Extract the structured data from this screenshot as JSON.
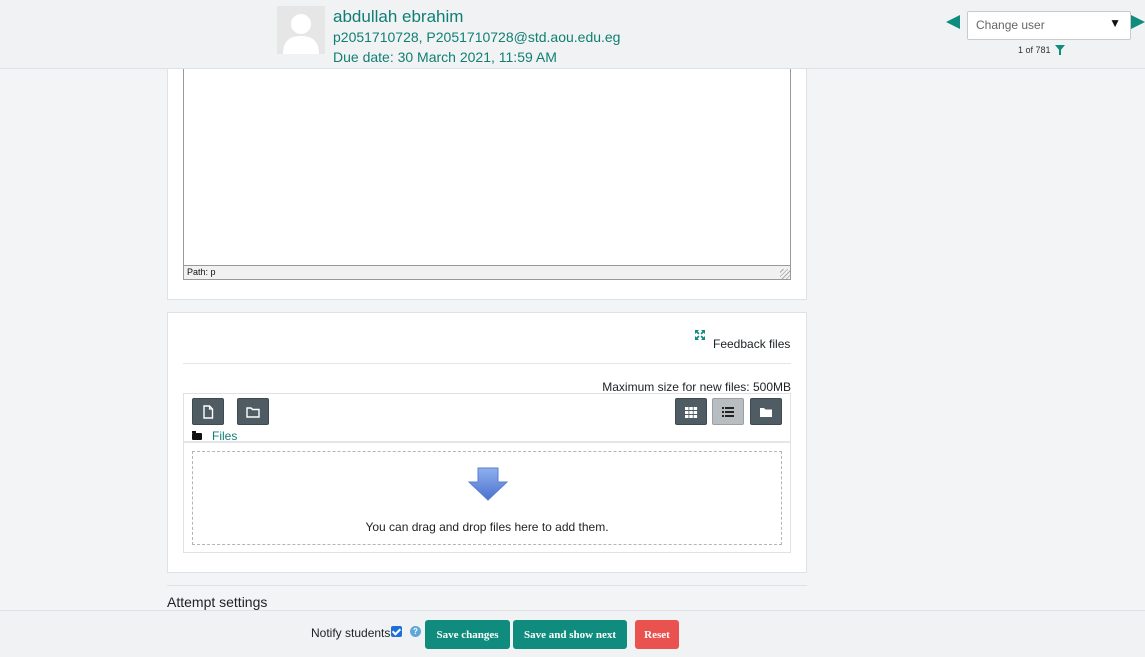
{
  "header": {
    "user_name": "abdullah ebrahim",
    "user_ids": "p2051710728, P2051710728@std.aou.edu.eg",
    "due_date": "Due date: 30 March 2021, 11:59 AM",
    "change_user_placeholder": "Change user",
    "user_count": "1 of 781",
    "accent_color": "#0f8c7e"
  },
  "editor": {
    "path_label": "Path: p"
  },
  "feedback_files": {
    "section_label": "Feedback files",
    "max_size": "Maximum size for new files: 500MB",
    "breadcrumb_label": "Files",
    "drop_text": "You can drag and drop files here to add them.",
    "toolbar_icons": [
      "add-file-icon",
      "create-folder-icon",
      "grid-view-icon",
      "list-view-icon",
      "folder-view-icon"
    ]
  },
  "attempt_settings": {
    "title": "Attempt settings"
  },
  "footer": {
    "notify_label": "Notify students",
    "save_label": "Save changes",
    "save_next_label": "Save and show next",
    "reset_label": "Reset",
    "reset_color": "#e9524f"
  }
}
